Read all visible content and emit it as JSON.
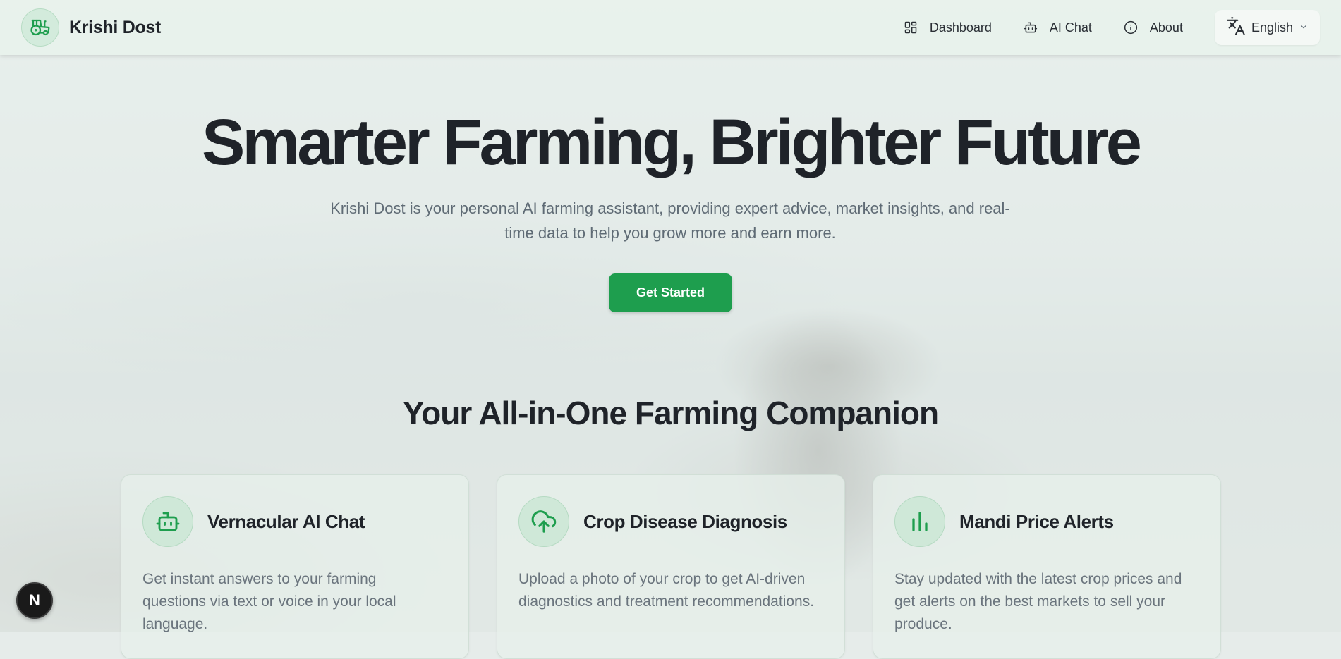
{
  "header": {
    "brand_name": "Krishi Dost",
    "nav": [
      {
        "label": "Dashboard",
        "icon": "dashboard-grid-icon"
      },
      {
        "label": "AI Chat",
        "icon": "bot-icon"
      },
      {
        "label": "About",
        "icon": "info-icon"
      }
    ],
    "language": {
      "label": "English",
      "icon": "translate-icon"
    }
  },
  "hero": {
    "title": "Smarter Farming, Brighter Future",
    "subtitle": "Krishi Dost is your personal AI farming assistant, providing expert advice, market insights, and real-time data to help you grow more and earn more.",
    "cta_label": "Get Started"
  },
  "features": {
    "title": "Your All-in-One Farming Companion",
    "cards": [
      {
        "title": "Vernacular AI Chat",
        "description": "Get instant answers to your farming questions via text or voice in your local language.",
        "icon": "bot-icon"
      },
      {
        "title": "Crop Disease Diagnosis",
        "description": "Upload a photo of your crop to get AI-driven diagnostics and treatment recommendations.",
        "icon": "cloud-upload-icon"
      },
      {
        "title": "Mandi Price Alerts",
        "description": "Stay updated with the latest crop prices and get alerts on the best markets to sell your produce.",
        "icon": "bar-chart-icon"
      }
    ]
  },
  "dev_badge": {
    "label": "N"
  },
  "colors": {
    "accent": "#1e9e4e",
    "text": "#1f2329",
    "muted": "#5f6b75"
  }
}
